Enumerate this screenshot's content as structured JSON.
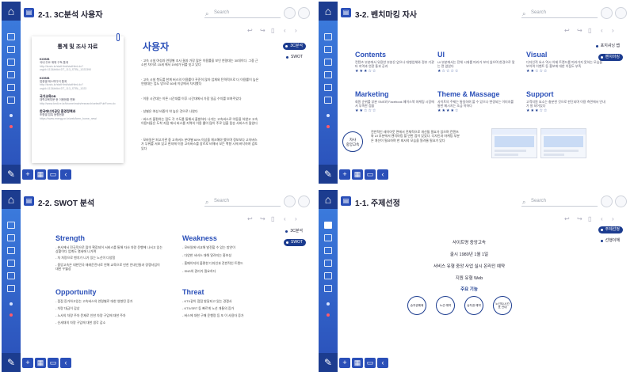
{
  "chrome": {
    "search_placeholder": "Search",
    "nav_back": "↩",
    "nav_forward": "↪",
    "nav_prev": "‹",
    "nav_next": "›",
    "accent_color": "#2a4fb8",
    "sidebar_color": "#3d7fe0"
  },
  "panel1": {
    "title": "2-1. 3C분석 사용자",
    "card_heading": "통계 및 조사 자료",
    "sources": [
      {
        "name": "KOSIS",
        "desc": "국내 주요 매체 구독 통계",
        "url": "http://kosis.kr/statHtml/statHtml.do?orgId=113&tblId=DT_113_STBL_1023390"
      },
      {
        "name": "KOSIS",
        "desc": "업종별 매스미디어 통계",
        "url": "http://kosis.kr/statHtml/statHtml.do?orgId=113&tblId=DT_113_STBL_1023"
      },
      {
        "name": "국가교육DB",
        "desc": "대학교육부문 현 이용현황 변화",
        "url": "http://www.kedi.re.kr/khome/main/research/selectPubForm.do"
      },
      {
        "name": "한국에너지공단 환경정책과",
        "desc": "조합별 접촉 동향현황",
        "url": "https://www.energy.or.kr/web/kem_home_new/"
      }
    ],
    "heading": "사용자",
    "bullets": [
      "· 고속 시설 여성과 연령별 조사 결과 가장 많은 이용률을 보인 연령대는 30대이다. 그중 근소한 차이로 15세 에서 19세가 뒤를 잇고 있다",
      "· 고속 시설 복도를 한계 버스의 이용률이 꾸준히 많아 업체와 탄력적으로 더 이용률이 높은 연령대는 업도 망으로 60세 이상에서 차지했다",
      "· 이용 시간대는 이른 시간대를 이후 시간대에서 가장 일곱 수치를 보여주었다",
      "· 성별은 여성 비중이 약 높은 것으로 나왔다",
      "· 버스가 불편하는 점도 각 수도를 통해서 출발하다 나가는 고속버스로 이동을 하였고 고속 이용자들은 도착 지점 에서 버스를 지역의 이용 률이 많이 주로 입출 탑승 서비스가 많았다",
      "· 모바일은 퍼고기관 중 고속버스 분야별 60% 이상을 체크해야 했으며 정보보다 고속버스가 무위를 서포 있고 현지에 이용 고속버스를 장르로 비해서 모든 백향 시에 바닥하여 검토 있다"
    ],
    "side_pills": [
      "3C분석",
      "SWOT"
    ]
  },
  "panel2": {
    "title": "3-2. 벤치마킹 자사",
    "categories": [
      {
        "title": "Contents",
        "desc": "컨텐츠 부분에서 유용한 부분은 없으나 대형업체와 정부 기관 타 지역과 연관 통과 공과",
        "stars": "★★★☆☆"
      },
      {
        "title": "UI",
        "desc": "UI 부분에서는 전체 시대를 따라가 보지 않으며 한경으로 맞는 면 없었다",
        "stars": "★☆☆☆☆"
      },
      {
        "title": "Visual",
        "desc": "디자인적 요소 역시 이제 트렌드를 따라가지 못하는 모습을 보이며 이벤트 등 홍보에 대한 이점도 부족",
        "stars": "★★☆☆☆"
      },
      {
        "title": "Marketing",
        "desc": "회원 순위를 부분 SNS와 Facebook 페이스북 마케팅 시장에서 부족한 점을",
        "stars": "★★☆☆☆"
      },
      {
        "title": "Theme & Massage",
        "desc": "사이트의 주제는 통일하여 볼 수 있으나 변경되는 이미지를 통한 메시지는 조금 약하다",
        "stars": "★★★★☆"
      },
      {
        "title": "Support",
        "desc": "고객지원 요소는 충분한 것으로 판단되며 이용 측면에서 안내가 잘 되어있다",
        "stars": "★★★☆☆"
      }
    ],
    "circle_label": "자사\n중앙고속",
    "summary": "전반적인 레이아웃 면에서 전체적으로 개선될 필요가 있으며 컨텐츠와 UI 부분에서 벤치마킹 할 만한 점이 있었다. 디자인과 마케팅 부분은 개선이 필요하며 한 회사의 모습을 알려줄 필요가 있다",
    "side_pills": [
      "포지셔닝 맵",
      "벤치마킹"
    ]
  },
  "panel3": {
    "title": "2-2. SWOT 분석",
    "strength": {
      "title": "Strength",
      "items": [
        "- 본사에서 전국적으로 많이 확장되어 서비스를 통해 자사 차량 운행에 나서고 있는 상황이다 업계도 열세에 나가며",
        "- 차 차량으로 벤치가 나가 있는 노선이 다양함",
        "- 중앙고속은 대한민국 재래운전사로 연해 교육으로 만한 안내인들과 경쟁사업이 대한 우월성"
      ]
    },
    "weakness": {
      "title": "Weakness",
      "items": [
        "- 모바일에 비교해 발전할 수 있는 방안이",
        "- 다양한 서비스 대해 알려지는 홍보성",
        "- 홈페이지의 불편한 디자인과 전반적인 트렌드",
        "- SNS의 관리가 필요하다"
      ]
    },
    "opportunity": {
      "title": "Opportunity",
      "items": [
        "- 점점 증가하고있는 고속버스의 연령별로 대한 영향된 증가",
        "- 차량 대금이 감상",
        "- 노사의 차량 주차 문제로 인한 차량 구입에 대한 주차",
        "- 신세대의 차량 구입에 대한 생각 감소"
      ]
    },
    "threat": {
      "title": "Threat",
      "items": [
        "- KTX같이 점점 발달되고 있는 경쟁사",
        "- KTX/SRT 등 빠르게 노선 개통의 증가",
        "- 버스에 대한 구매 운행량 등 또 이 사용자 증가"
      ]
    },
    "side_pills": [
      "3C분석",
      "SWOT"
    ]
  },
  "panel4": {
    "title": "1-1. 주제선정",
    "site_name": "사이트명 중앙고속",
    "founded": "출시 1980년 1월 1일",
    "service": "서비스 유형 중앙 사업 실시 온라인 예약",
    "region": "지원 유형 Web",
    "func_head": "주요 기능",
    "functions": [
      "승차권예매",
      "노선 예약",
      "승차권 예약",
      "노선도/시간표 안내"
    ],
    "side_pills": [
      "주제선정",
      "선행이해"
    ]
  }
}
